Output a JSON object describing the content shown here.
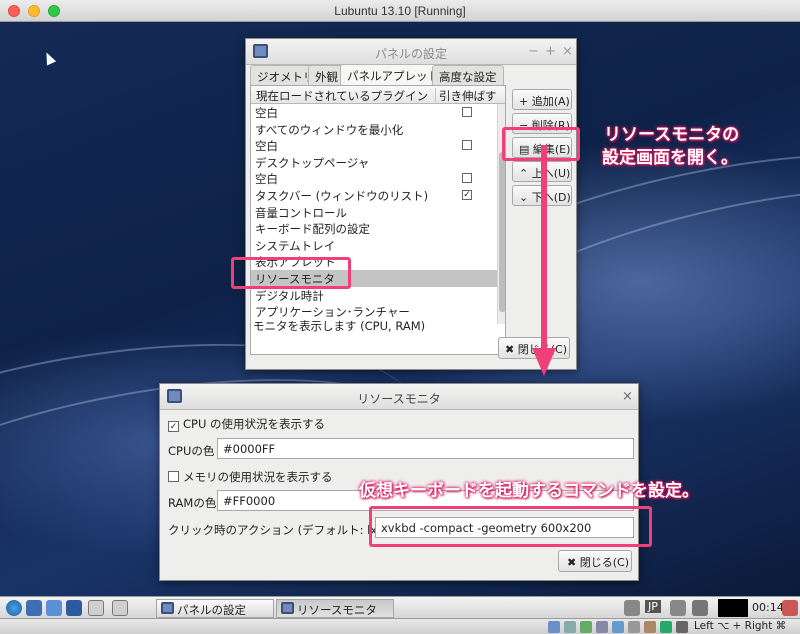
{
  "mac_window": {
    "title": "Lubuntu 13.10 [Running]"
  },
  "panel_settings": {
    "title": "パネルの設定",
    "controls": {
      "minimize": "−",
      "maximize": "+",
      "close": "×"
    },
    "tabs": [
      "ジオメトリ",
      "外観",
      "パネルアプレット",
      "高度な設定"
    ],
    "list_headers": {
      "plugin": "現在ロードされているプラグイン",
      "stretch": "引き伸ばす"
    },
    "plugins": [
      {
        "name": "空白",
        "checkbox": "empty"
      },
      {
        "name": "すべてのウィンドウを最小化",
        "checkbox": "none"
      },
      {
        "name": "空白",
        "checkbox": "empty"
      },
      {
        "name": "デスクトップページャ",
        "checkbox": "none"
      },
      {
        "name": "空白",
        "checkbox": "empty"
      },
      {
        "name": "タスクバー (ウィンドウのリスト)",
        "checkbox": "checked"
      },
      {
        "name": "音量コントロール",
        "checkbox": "none"
      },
      {
        "name": "キーボード配列の設定",
        "checkbox": "none"
      },
      {
        "name": "システムトレイ",
        "checkbox": "none"
      },
      {
        "name": "表示アプレット",
        "checkbox": "none"
      },
      {
        "name": "リソースモニタ",
        "checkbox": "none",
        "selected": true
      },
      {
        "name": "デジタル時計",
        "checkbox": "none"
      },
      {
        "name": "アプリケーション･ランチャー",
        "checkbox": "none"
      }
    ],
    "buttons": {
      "add": "+ 追加(A)",
      "remove": "− 削除(R)",
      "edit": "編集(E)",
      "up": "上へ(U)",
      "down": "下へ(D)"
    },
    "status": "モニタを表示します (CPU, RAM)",
    "close_button": "閉じる(C)"
  },
  "resource_monitor": {
    "title": "リソースモニタ",
    "cpu_checkbox_label": "CPU の使用状況を表示する",
    "cpu_checked": true,
    "cpu_color_label": "CPUの色",
    "cpu_color_value": "#0000FF",
    "ram_checkbox_label": "メモリの使用状況を表示する",
    "ram_checked": false,
    "ram_color_label": "RAMの色",
    "ram_color_value": "#FF0000",
    "click_action_label": "クリック時のアクション (デフォルト: lxtask)",
    "click_action_value": "xvkbd -compact -geometry 600x200",
    "close_button": "閉じる(C)"
  },
  "annotations": {
    "note1_line1": "リソースモニタの",
    "note1_line2": "設定画面を開く。",
    "note2": "仮想キーボードを起動するコマンドを設定。",
    "color": "#f0407a"
  },
  "taskbar": {
    "tasks": [
      "パネルの設定",
      "リソースモニタ"
    ],
    "keyboard_layout": "JP",
    "clock": "00:14"
  },
  "vbox_status": {
    "host_key": "Left ⌥ + Right ⌘"
  }
}
